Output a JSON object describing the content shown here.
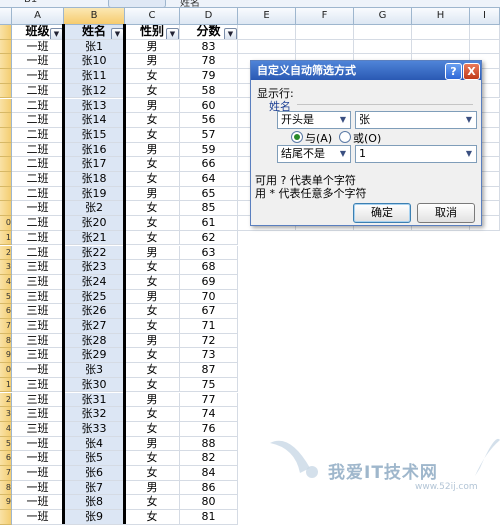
{
  "formula_bar": {
    "cell_ref": "B1",
    "content": "姓名"
  },
  "columns": [
    "A",
    "B",
    "C",
    "D",
    "E",
    "F",
    "G",
    "H",
    "I"
  ],
  "row_numbers": [
    "",
    "",
    "",
    "",
    "",
    "",
    "",
    "",
    "",
    "0",
    "1",
    "2",
    "3",
    "4",
    "5",
    "6",
    "7",
    "8",
    "9",
    "0",
    "1",
    "2",
    "3",
    "4",
    "5",
    "6",
    "7",
    "8",
    "9"
  ],
  "table": {
    "headers": [
      "班级",
      "姓名",
      "性别",
      "分数"
    ],
    "rows": [
      [
        "一班",
        "张1",
        "男",
        "83"
      ],
      [
        "一班",
        "张10",
        "男",
        "78"
      ],
      [
        "一班",
        "张11",
        "女",
        "79"
      ],
      [
        "二班",
        "张12",
        "女",
        "58"
      ],
      [
        "二班",
        "张13",
        "男",
        "60"
      ],
      [
        "二班",
        "张14",
        "女",
        "56"
      ],
      [
        "二班",
        "张15",
        "女",
        "57"
      ],
      [
        "二班",
        "张16",
        "男",
        "59"
      ],
      [
        "二班",
        "张17",
        "女",
        "66"
      ],
      [
        "二班",
        "张18",
        "女",
        "64"
      ],
      [
        "二班",
        "张19",
        "男",
        "65"
      ],
      [
        "一班",
        "张2",
        "女",
        "85"
      ],
      [
        "二班",
        "张20",
        "女",
        "61"
      ],
      [
        "二班",
        "张21",
        "女",
        "62"
      ],
      [
        "二班",
        "张22",
        "男",
        "63"
      ],
      [
        "三班",
        "张23",
        "女",
        "68"
      ],
      [
        "三班",
        "张24",
        "女",
        "69"
      ],
      [
        "三班",
        "张25",
        "男",
        "70"
      ],
      [
        "三班",
        "张26",
        "女",
        "67"
      ],
      [
        "三班",
        "张27",
        "女",
        "71"
      ],
      [
        "三班",
        "张28",
        "男",
        "72"
      ],
      [
        "三班",
        "张29",
        "女",
        "73"
      ],
      [
        "一班",
        "张3",
        "女",
        "87"
      ],
      [
        "三班",
        "张30",
        "女",
        "75"
      ],
      [
        "三班",
        "张31",
        "男",
        "77"
      ],
      [
        "三班",
        "张32",
        "女",
        "74"
      ],
      [
        "三班",
        "张33",
        "女",
        "76"
      ],
      [
        "一班",
        "张4",
        "男",
        "88"
      ],
      [
        "一班",
        "张5",
        "女",
        "82"
      ],
      [
        "一班",
        "张6",
        "女",
        "84"
      ],
      [
        "一班",
        "张7",
        "男",
        "86"
      ],
      [
        "一班",
        "张8",
        "女",
        "80"
      ],
      [
        "一班",
        "张9",
        "女",
        "81"
      ]
    ]
  },
  "dialog": {
    "title": "自定义自动筛选方式",
    "help_label": "?",
    "close_label": "X",
    "show_rows_label": "显示行:",
    "field_label": "姓名",
    "condition1": {
      "operator": "开头是",
      "value": "张"
    },
    "logic": {
      "and_label": "与(A)",
      "or_label": "或(O)",
      "selected": "and"
    },
    "condition2": {
      "operator": "结尾不是",
      "value": "1"
    },
    "hint1": "可用 ? 代表单个字符",
    "hint2": "用 * 代表任意多个字符",
    "ok_label": "确定",
    "cancel_label": "取消"
  },
  "watermark": {
    "text": "我爱IT技术网",
    "url": "www.52ij.com"
  },
  "colors": {
    "selected_column": "#dce6f4",
    "title_bar": "#2a59b3",
    "header_gold": "#f4cd71"
  }
}
